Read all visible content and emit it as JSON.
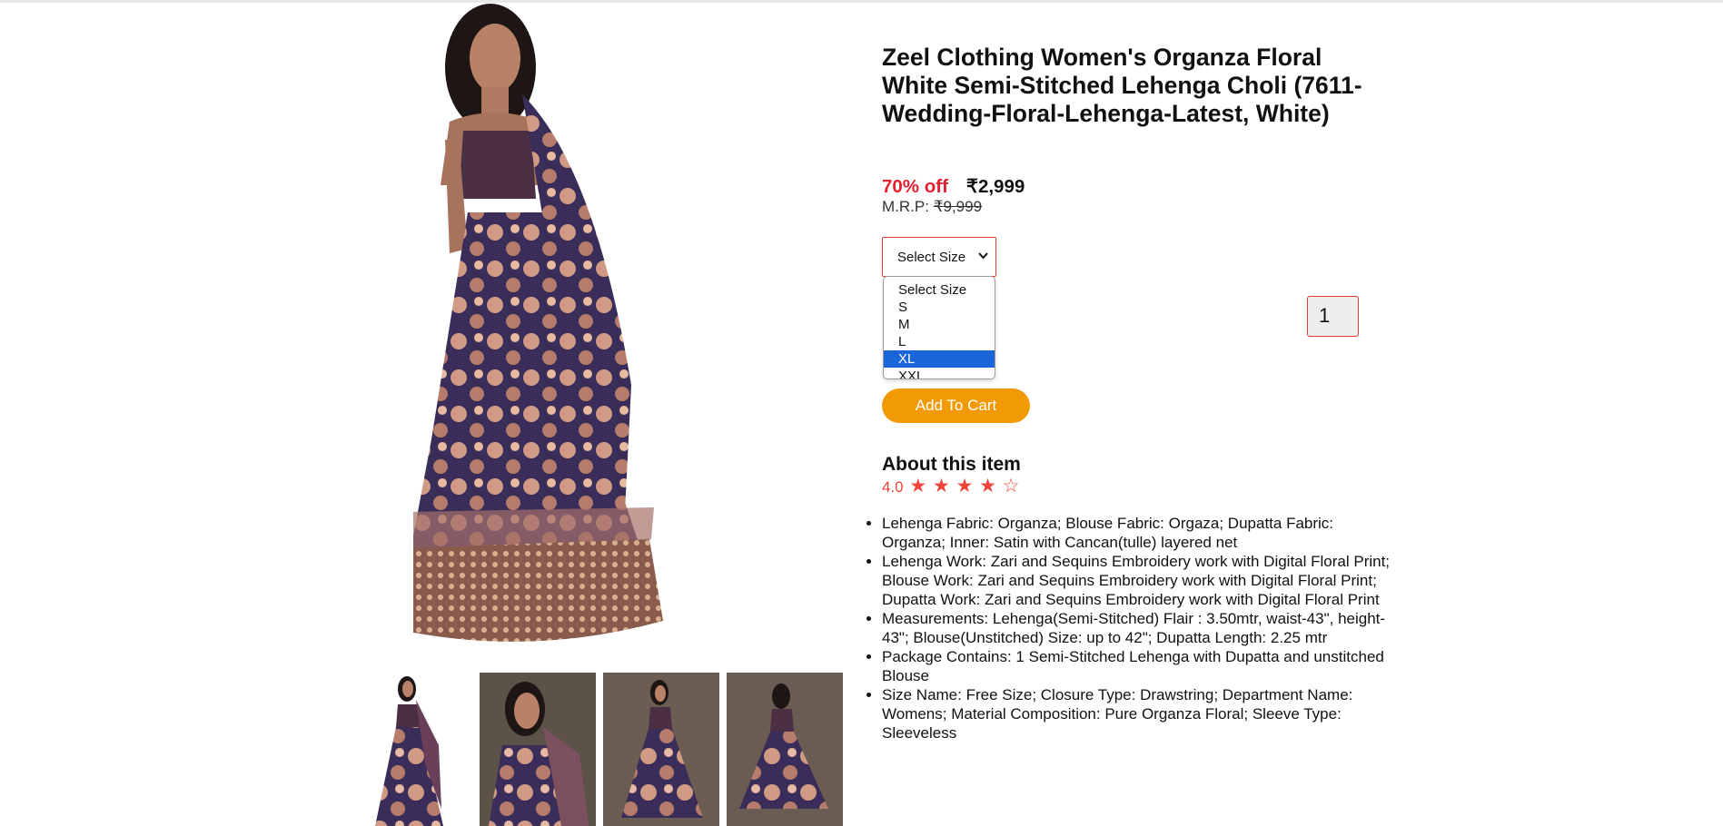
{
  "product": {
    "title": "Zeel Clothing Women's Organza Floral White Semi-Stitched Lehenga Choli (7611-Wedding-Floral-Lehenga-Latest, White)",
    "discount": "70% off",
    "price": "₹2,999",
    "mrp_label": "M.R.P:",
    "mrp_value": "₹9,999"
  },
  "size_select": {
    "selected": "Select Size",
    "options": [
      "Select Size",
      "S",
      "M",
      "L",
      "XL",
      "XXL"
    ],
    "highlighted": "XL"
  },
  "quantity": "1",
  "add_to_cart_label": "Add To Cart",
  "about": {
    "title": "About this item",
    "rating": "4.0",
    "stars": [
      "★",
      "★",
      "★",
      "★",
      "☆"
    ],
    "bullets": [
      "Lehenga Fabric: Organza; Blouse Fabric: Orgaza; Dupatta Fabric: Organza; Inner: Satin with Cancan(tulle) layered net",
      "Lehenga Work: Zari and Sequins Embroidery work with Digital Floral Print; Blouse Work: Zari and Sequins Embroidery work with Digital Floral Print; Dupatta Work: Zari and Sequins Embroidery work with Digital Floral Print",
      "Measurements: Lehenga(Semi-Stitched) Flair : 3.50mtr, waist-43\", height-43\"; Blouse(Unstitched) Size: up to 42\"; Dupatta Length: 2.25 mtr",
      "Package Contains: 1 Semi-Stitched Lehenga with Dupatta and unstitched Blouse",
      "Size Name: Free Size; Closure Type: Drawstring; Department Name: Womens; Material Composition: Pure Organza Floral; Sleeve Type: Sleeveless"
    ]
  },
  "colors": {
    "discount": "#e4202f",
    "accent_button": "#f29a05",
    "border_red": "#e53935",
    "highlight_blue": "#1a66d9",
    "rating": "#f0443b"
  }
}
